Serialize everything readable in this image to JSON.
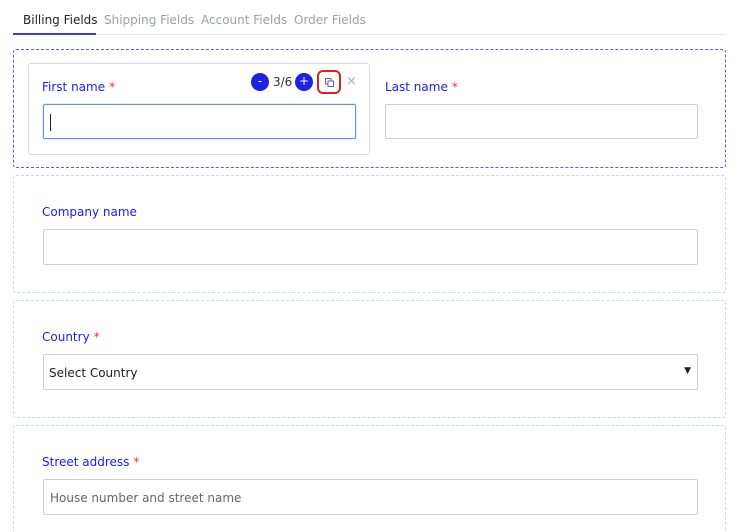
{
  "tabs": [
    {
      "label": "Billing Fields",
      "active": true
    },
    {
      "label": "Shipping Fields",
      "active": false
    },
    {
      "label": "Account Fields",
      "active": false
    },
    {
      "label": "Order Fields",
      "active": false
    }
  ],
  "toolbar": {
    "decrement": "-",
    "counter": "3/6",
    "increment": "+",
    "close": "×"
  },
  "fields": {
    "first_name": {
      "label": "First name",
      "required_mark": "*",
      "value": ""
    },
    "last_name": {
      "label": "Last name",
      "required_mark": "*",
      "value": ""
    },
    "company": {
      "label": "Company name",
      "value": ""
    },
    "country": {
      "label": "Country",
      "required_mark": "*",
      "selected": "Select Country"
    },
    "street": {
      "label": "Street address",
      "required_mark": "*",
      "placeholder": "House number and street name"
    }
  },
  "colors": {
    "accent": "#1e22e6",
    "label": "#1a1aff",
    "required": "#e53935",
    "highlight": "#e02020"
  },
  "icons": {
    "copy": "copy-icon",
    "close": "close-icon",
    "dropdown": "caret-down-icon"
  }
}
